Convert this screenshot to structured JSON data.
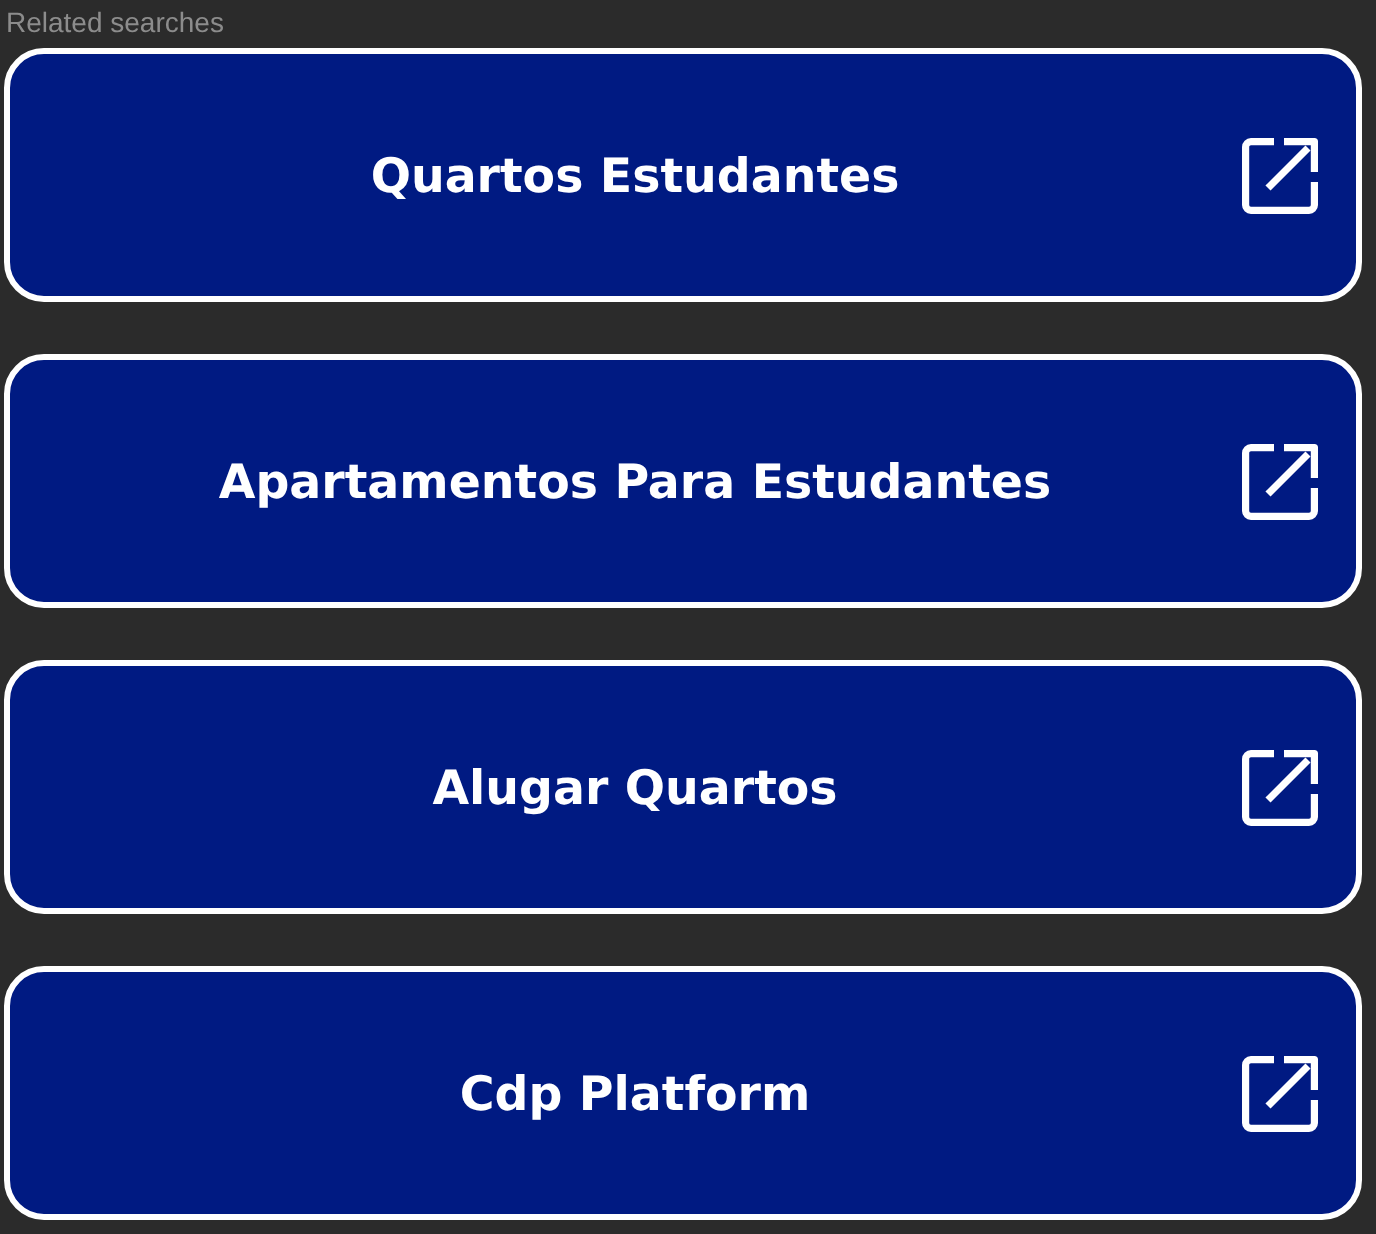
{
  "header": "Related searches",
  "searches": [
    {
      "label": "Quartos Estudantes"
    },
    {
      "label": "Apartamentos Para Estudantes"
    },
    {
      "label": "Alugar Quartos"
    },
    {
      "label": "Cdp Platform"
    }
  ]
}
